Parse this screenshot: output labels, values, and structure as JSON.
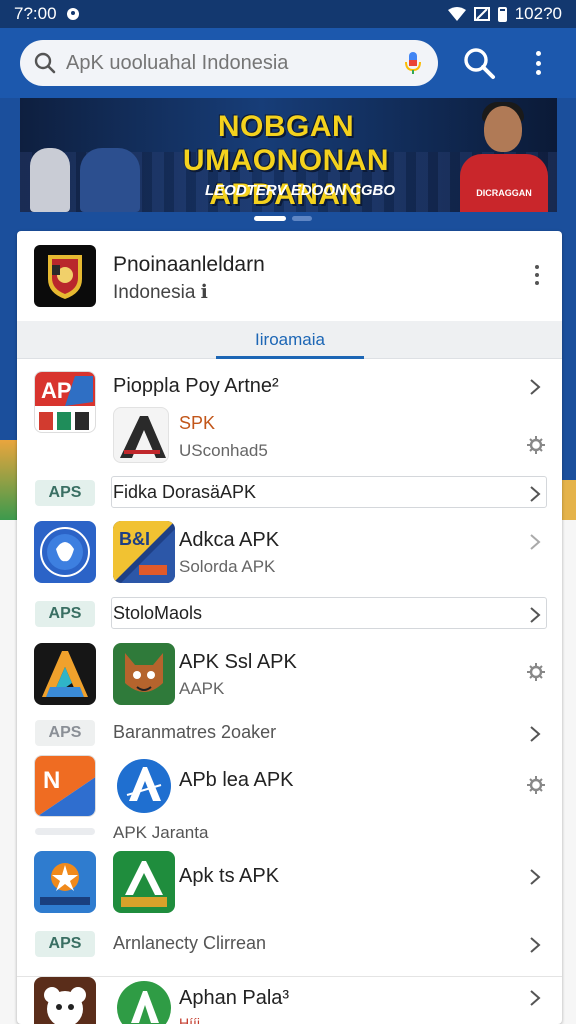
{
  "status_bar": {
    "time": "7?:00",
    "right_text": "102?0"
  },
  "search": {
    "placeholder": "ApK uooluahal Indonesia"
  },
  "banner": {
    "headline_line1": "NOBGAN UMAONONAN",
    "headline_line2": "APDANAN INDONESAN",
    "subline": "LEODTERV EDOON CGBO",
    "shirt_text": "DICRAGGAN"
  },
  "featured": {
    "title": "Pnoinaanleldarn",
    "subtitle": "Indonesia ℹ"
  },
  "tab": {
    "label": "Iiroamaia"
  },
  "apps": [
    {
      "name": "Pioppla Poy Artne²",
      "action": "chevron"
    },
    {
      "name": "SPK",
      "sub": "USconhad5",
      "name_color": "#c2561a",
      "action": "gear"
    },
    {
      "name": "Adkca APK",
      "sub": "Solorda APK",
      "action": "chevron"
    },
    {
      "name": "APK Ssl APK",
      "sub": "AAPK",
      "action": "gear"
    },
    {
      "name": "APb lea APK",
      "action": "gear"
    },
    {
      "name": "Apk ts APK",
      "action": "chevron"
    },
    {
      "name": "Aphan Pala³",
      "sub": "Hííi",
      "action": "chevron"
    }
  ],
  "sections": [
    {
      "badge": "APS",
      "label": "Fidka DorasäAPK"
    },
    {
      "badge": "APS",
      "label": "StoloMaols"
    },
    {
      "badge": "APS",
      "label": "Baranmatres 2oaker"
    },
    {
      "badge": "",
      "label": "APK Jaranta"
    },
    {
      "badge": "APS",
      "label": "Arnlanecty Clirrean"
    }
  ],
  "colors": {
    "primary": "#1c58ad",
    "status_bar": "#13386f",
    "accent_tab": "#1c66b5",
    "headline_yellow": "#f4d21e"
  },
  "icons": [
    "notification-icon",
    "wifi-icon",
    "no-sim-icon",
    "battery-icon",
    "search-icon",
    "mic-icon",
    "more-vert-icon",
    "chevron-right-icon",
    "gear-icon"
  ]
}
